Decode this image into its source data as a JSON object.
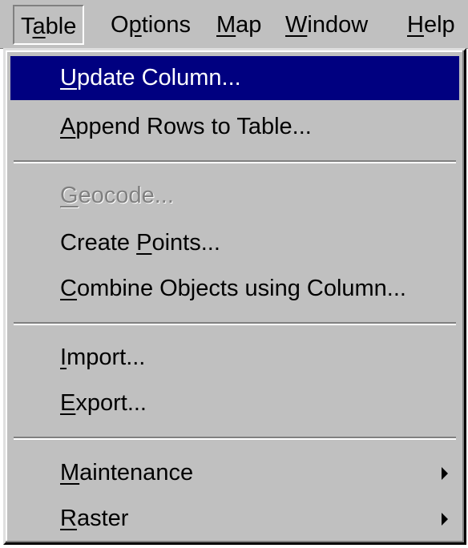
{
  "menubar": {
    "items": [
      {
        "pre": "T",
        "key": "a",
        "post": "ble"
      },
      {
        "pre": "O",
        "key": "p",
        "post": "tions"
      },
      {
        "pre": "",
        "key": "M",
        "post": "ap"
      },
      {
        "pre": "",
        "key": "W",
        "post": "indow"
      },
      {
        "pre": "",
        "key": "H",
        "post": "elp"
      }
    ]
  },
  "menu": {
    "items": [
      {
        "key": "U",
        "post": "pdate Column...",
        "state": "highlighted"
      },
      {
        "key": "A",
        "post": "ppend Rows to Table...",
        "state": "enabled"
      },
      {
        "key": "G",
        "post": "eocode...",
        "state": "disabled"
      },
      {
        "pre": "Create ",
        "key": "P",
        "post": "oints...",
        "state": "enabled"
      },
      {
        "key": "C",
        "post": "ombine Objects using Column...",
        "state": "enabled"
      },
      {
        "key": "I",
        "post": "mport...",
        "state": "enabled"
      },
      {
        "key": "E",
        "post": "xport...",
        "state": "enabled"
      },
      {
        "key": "M",
        "post": "aintenance",
        "state": "enabled",
        "submenu": true,
        "arrow_icon": "submenu-arrow-icon"
      },
      {
        "key": "R",
        "post": "aster",
        "state": "enabled",
        "submenu": true,
        "arrow_icon": "submenu-arrow-icon"
      }
    ]
  },
  "colors": {
    "menu_background": "#c0c0c0",
    "highlight": "#000080",
    "highlight_text": "#ffffff",
    "disabled_text": "#808080"
  }
}
